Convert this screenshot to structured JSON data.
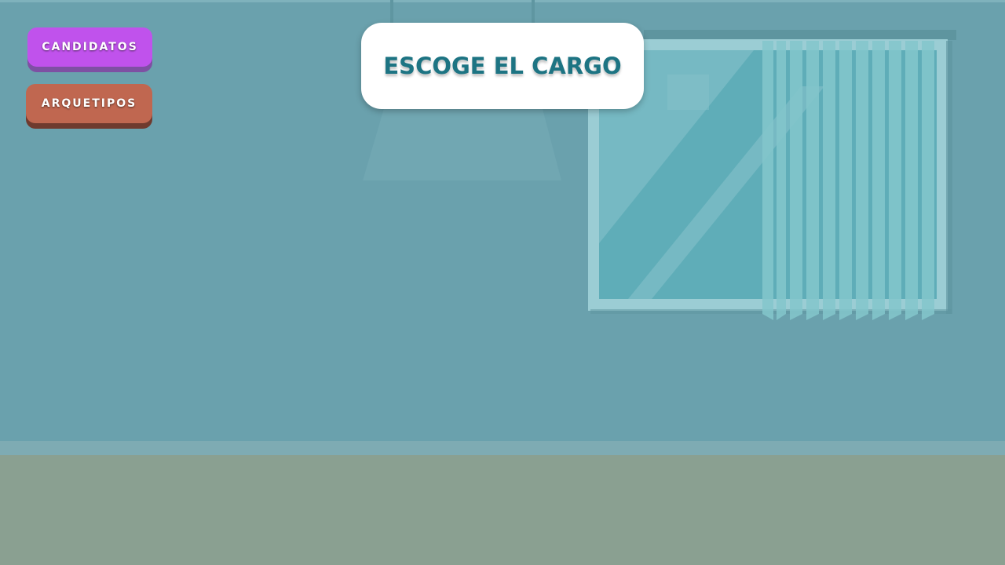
{
  "menu": {
    "candidatos_label": "CANDIDATOS",
    "arquetipos_label": "ARQUETIPOS"
  },
  "header": {
    "title": "ESCOGE EL CARGO"
  },
  "colors": {
    "wall": "#6aa1ad",
    "floor": "#8aa091",
    "candidatos_button": "#c052ec",
    "arquetipos_button": "#c06750",
    "title_text": "#1d7483"
  }
}
